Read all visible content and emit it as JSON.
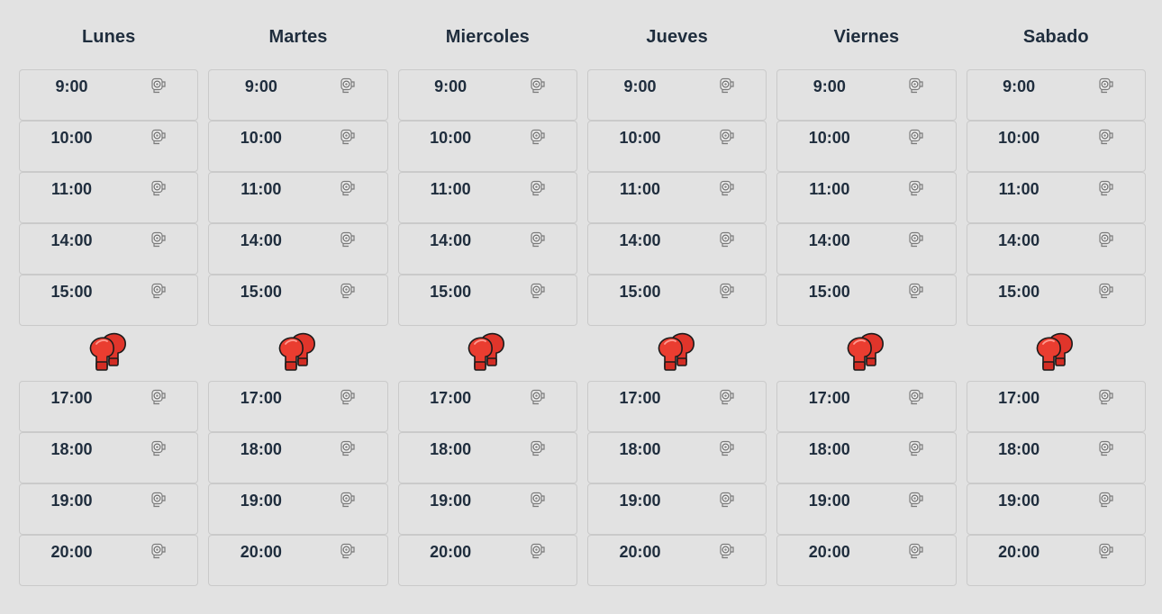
{
  "days": [
    {
      "label": "Lunes",
      "key": "lunes"
    },
    {
      "label": "Martes",
      "key": "martes"
    },
    {
      "label": "Miercoles",
      "key": "miercoles"
    },
    {
      "label": "Jueves",
      "key": "jueves"
    },
    {
      "label": "Viernes",
      "key": "viernes"
    },
    {
      "label": "Sabado",
      "key": "sabado"
    }
  ],
  "morning_slots": [
    "9:00",
    "10:00",
    "11:00",
    "14:00",
    "15:00"
  ],
  "evening_slots": [
    "17:00",
    "18:00",
    "19:00",
    "20:00"
  ],
  "icons": {
    "slot_icon": "cctv-camera-icon",
    "break_icon": "boxing-gloves-icon"
  },
  "colors": {
    "background": "#e2e2e2",
    "text": "#1f2d3d",
    "slot_border": "#cacaca",
    "glove_red": "#e63a2e"
  }
}
